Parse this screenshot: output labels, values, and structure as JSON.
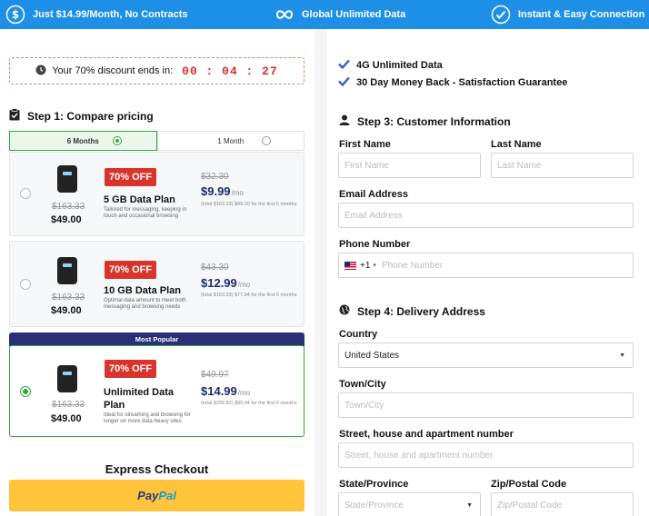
{
  "topbar": {
    "items": [
      {
        "icon": "dollar-icon",
        "label": "Just $14.99/Month, No Contracts"
      },
      {
        "icon": "infinity-icon",
        "label": "Global Unlimited Data"
      },
      {
        "icon": "check-circle-icon",
        "label": "Instant & Easy Connection"
      }
    ]
  },
  "timer": {
    "label": "Your 70% discount ends in:",
    "time": "00 : 04 : 27"
  },
  "step1": {
    "title": "Step 1: Compare pricing"
  },
  "toggle": {
    "options": [
      "6 Months",
      "1 Month"
    ],
    "selected": "6 Months"
  },
  "plans": [
    {
      "old_total": "$163.33",
      "total": "$49.00",
      "badge": "70% OFF",
      "name": "5 GB Data Plan",
      "desc": "Tailored for messaging, keeping in touch and occasional browsing",
      "old_monthly": "$32.30",
      "monthly": "$9.99",
      "per": "/mo",
      "fine": "(total $163.33) $49.00 for the first 6 months"
    },
    {
      "old_total": "$163.33",
      "total": "$49.00",
      "badge": "70% OFF",
      "name": "10 GB Data Plan",
      "desc": "Optimal data amount to meet both messaging and browsing needs",
      "old_monthly": "$43.30",
      "monthly": "$12.99",
      "per": "/mo",
      "fine": "(total $163.33) $77.94 for the first 6 months"
    },
    {
      "old_total": "$163.33",
      "total": "$49.00",
      "badge": "70% OFF",
      "name": "Unlimited Data Plan",
      "desc": "Ideal for streaming and browsing for longer on more data-heavy sites",
      "old_monthly": "$49.97",
      "monthly": "$14.99",
      "per": "/mo",
      "fine": "(total $299.82) $89.94 for the first 6 months"
    }
  ],
  "most_popular": "Most Popular",
  "express": {
    "title": "Express Checkout",
    "paypal_a": "Pay",
    "paypal_b": "Pal"
  },
  "guarantees": [
    "4G Unlimited Data",
    "30 Day Money Back - Satisfaction Guarantee"
  ],
  "step3": {
    "title": "Step 3: Customer Information",
    "first_name_label": "First Name",
    "first_name_placeholder": "First Name",
    "last_name_label": "Last Name",
    "last_name_placeholder": "Last Name",
    "email_label": "Email Address",
    "email_placeholder": "Email Address",
    "phone_label": "Phone Number",
    "phone_code": "+1",
    "phone_placeholder": "Phone Number"
  },
  "step4": {
    "title": "Step 4: Delivery Address",
    "country_label": "Country",
    "country_value": "United States",
    "city_label": "Town/City",
    "city_placeholder": "Town/City",
    "street_label": "Street, house and apartment number",
    "street_placeholder": "Street, house and apartment number",
    "state_label": "State/Province",
    "state_placeholder": "State/Province",
    "zip_label": "Zip/Postal Code",
    "zip_placeholder": "Zip/Postal Code"
  }
}
